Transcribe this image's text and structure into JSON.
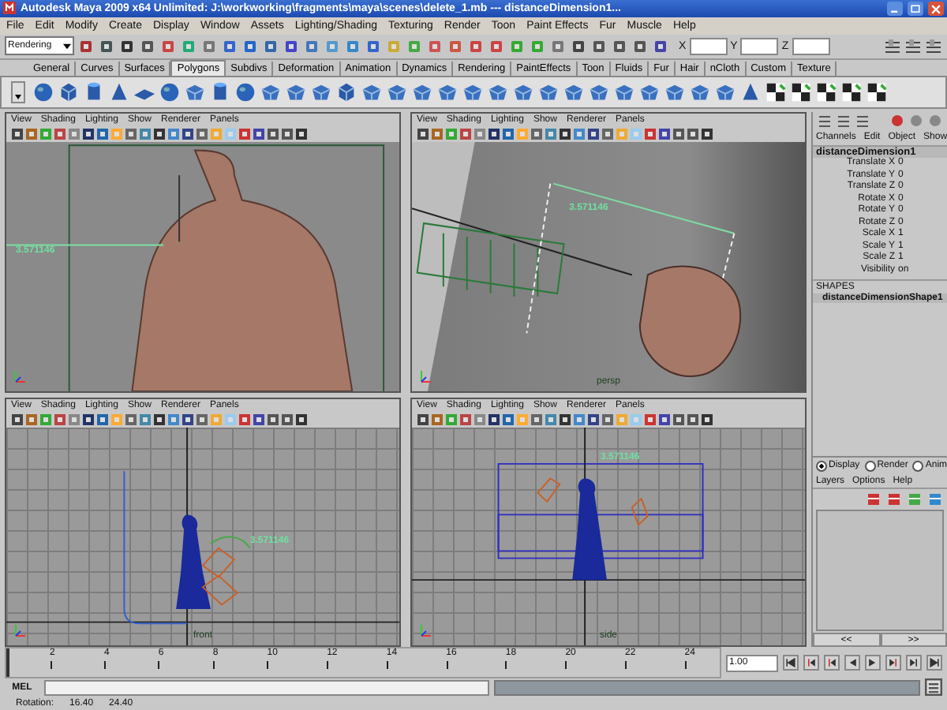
{
  "window": {
    "title": "Autodesk Maya 2009 x64 Unlimited: J:\\workworking\\fragments\\maya\\scenes\\delete_1.mb  ---  distanceDimension1..."
  },
  "menubar": [
    "File",
    "Edit",
    "Modify",
    "Create",
    "Display",
    "Window",
    "Assets",
    "Lighting/Shading",
    "Texturing",
    "Render",
    "Toon",
    "Paint Effects",
    "Fur",
    "Muscle",
    "Help"
  ],
  "status_line": {
    "mode": "Rendering",
    "fields": [
      "X",
      "Y",
      "Z"
    ]
  },
  "shelf_tabs": [
    {
      "label": "General",
      "selected": false
    },
    {
      "label": "Curves",
      "selected": false
    },
    {
      "label": "Surfaces",
      "selected": false
    },
    {
      "label": "Polygons",
      "selected": true
    },
    {
      "label": "Subdivs",
      "selected": false
    },
    {
      "label": "Deformation",
      "selected": false
    },
    {
      "label": "Animation",
      "selected": false
    },
    {
      "label": "Dynamics",
      "selected": false
    },
    {
      "label": "Rendering",
      "selected": false
    },
    {
      "label": "PaintEffects",
      "selected": false
    },
    {
      "label": "Toon",
      "selected": false
    },
    {
      "label": "Fluids",
      "selected": false
    },
    {
      "label": "Fur",
      "selected": false
    },
    {
      "label": "Hair",
      "selected": false
    },
    {
      "label": "nCloth",
      "selected": false
    },
    {
      "label": "Custom",
      "selected": false
    },
    {
      "label": "Texture",
      "selected": false
    }
  ],
  "viewports": [
    {
      "kind": "torso",
      "menus": [
        "View",
        "Shading",
        "Lighting",
        "Show",
        "Renderer",
        "Panels"
      ],
      "dimension": "3.571146"
    },
    {
      "kind": "perspective",
      "menus": [
        "View",
        "Shading",
        "Lighting",
        "Show",
        "Renderer",
        "Panels"
      ],
      "dimension": "3.571146",
      "camera": "persp"
    },
    {
      "kind": "grid",
      "menus": [
        "View",
        "Shading",
        "Lighting",
        "Show",
        "Renderer",
        "Panels"
      ],
      "dimension": "3.571146",
      "camera": "front"
    },
    {
      "kind": "grid-side",
      "menus": [
        "View",
        "Shading",
        "Lighting",
        "Show",
        "Renderer",
        "Panels"
      ],
      "dimension": "3.571146",
      "camera": "side"
    }
  ],
  "channel_box": {
    "menus": [
      "Channels",
      "Edit",
      "Object",
      "Show"
    ],
    "node": "distanceDimension1",
    "attributes": [
      {
        "name": "Translate X",
        "value": "0"
      },
      {
        "name": "Translate Y",
        "value": "0"
      },
      {
        "name": "Translate Z",
        "value": "0"
      },
      {
        "name": "Rotate X",
        "value": "0"
      },
      {
        "name": "Rotate Y",
        "value": "0"
      },
      {
        "name": "Rotate Z",
        "value": "0"
      },
      {
        "name": "Scale X",
        "value": "1"
      },
      {
        "name": "Scale Y",
        "value": "1"
      },
      {
        "name": "Scale Z",
        "value": "1"
      },
      {
        "name": "Visibility",
        "value": "on"
      }
    ],
    "shapes_header": "SHAPES",
    "shape": "distanceDimensionShape1"
  },
  "layer_editor": {
    "modes": [
      {
        "label": "Display",
        "selected": true
      },
      {
        "label": "Render",
        "selected": false
      },
      {
        "label": "Anim",
        "selected": false
      }
    ],
    "menus": [
      "Layers",
      "Options",
      "Help"
    ]
  },
  "range_buttons": [
    "<<",
    ">>"
  ],
  "timeline": {
    "ticks": [
      "2",
      "4",
      "6",
      "8",
      "10",
      "12",
      "14",
      "16",
      "18",
      "20",
      "22",
      "24"
    ],
    "current_frame": "1.00",
    "level": 0
  },
  "command_line": {
    "label": "MEL"
  },
  "help_line": {
    "label": "Rotation:",
    "values": [
      "16.40",
      "24.40"
    ]
  }
}
